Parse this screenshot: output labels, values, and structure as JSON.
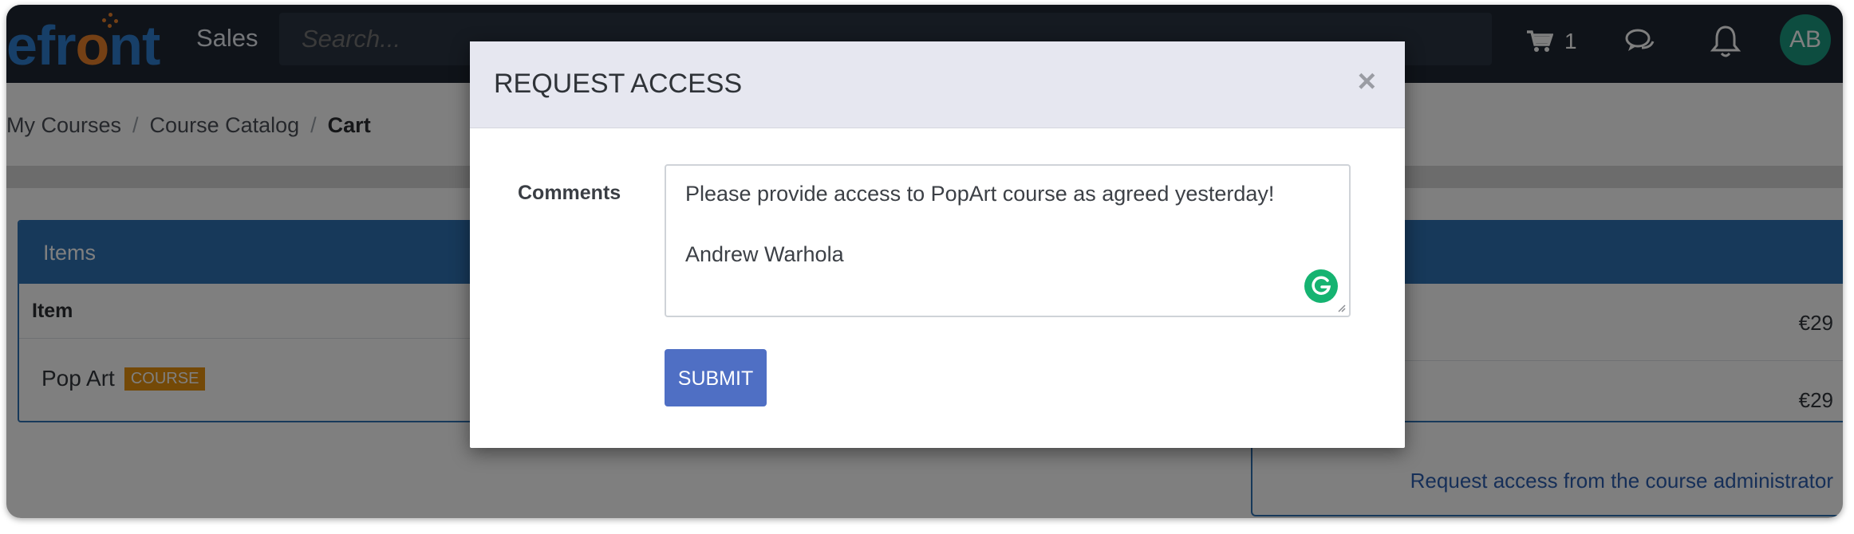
{
  "header": {
    "logo_text_a": "efr",
    "logo_text_b": "o",
    "logo_text_c": "nt",
    "app_name": "Sales",
    "search": {
      "placeholder": "Search..."
    },
    "cart": {
      "icon": "cart-icon",
      "count": "1"
    },
    "chat_icon": "chat-icon",
    "bell_icon": "bell-icon",
    "avatar_initials": "AB"
  },
  "breadcrumb": {
    "items": [
      "My Courses",
      "Course Catalog",
      "Cart"
    ],
    "separator": "/"
  },
  "items_panel": {
    "title": "Items",
    "column_header": "Item",
    "rows": [
      {
        "name": "Pop Art",
        "badge": "COURSE"
      }
    ]
  },
  "summary_panel": {
    "prices": [
      "€29",
      "€29"
    ],
    "request_link": "Request access from the course administrator"
  },
  "modal": {
    "title": "REQUEST ACCESS",
    "close_symbol": "×",
    "comments_label": "Comments",
    "comments_value_line1": "Please provide access to PopArt course as agreed yesterday!",
    "comments_value_line2": "Andrew Warhola",
    "submit_label": "SUBMIT"
  },
  "colors": {
    "topbar": "#1f2733",
    "accent_blue": "#2e72b4",
    "logo_orange": "#e8812a",
    "badge_orange": "#e8920e",
    "submit_blue": "#4f6fc4",
    "avatar_green": "#1a9a80",
    "grammarly_green": "#15b371"
  }
}
